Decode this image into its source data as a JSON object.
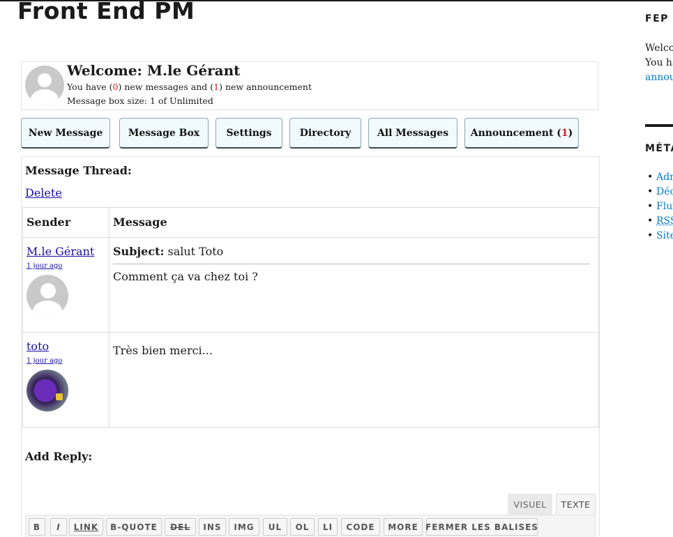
{
  "site": {
    "title": "Front End PM"
  },
  "header": {
    "welcome_prefix": "Welcome: ",
    "user_name": "M.le Gérant",
    "line1_a": "You have (",
    "new_messages": "0",
    "line1_b": ") new messages and (",
    "new_announcements": "1",
    "line1_c": ") new announcement",
    "line2": "Message box size: 1 of Unlimited"
  },
  "nav": {
    "new_message": "New Message",
    "message_box": "Message Box",
    "settings": "Settings",
    "directory": "Directory",
    "all_messages": "All Messages",
    "announcement_label": "Announcement (",
    "announcement_count": "1",
    "announcement_close": ")"
  },
  "thread": {
    "heading": "Message Thread:",
    "delete": "Delete",
    "columns": {
      "sender": "Sender",
      "message": "Message"
    },
    "messages": [
      {
        "sender": "M.le Gérant",
        "time": "1 jour ago",
        "subject_label": "Subject:",
        "subject": "salut Toto",
        "body": "Comment ça va chez toi ?"
      },
      {
        "sender": "toto",
        "time": "1 jour ago",
        "body": "Très bien merci..."
      }
    ],
    "add_reply": "Add Reply:"
  },
  "editor": {
    "tabs": {
      "visuel": "VISUEL",
      "texte": "TEXTE"
    },
    "buttons": {
      "b": "B",
      "i": "I",
      "link": "LINK",
      "bquote": "B-QUOTE",
      "del": "DEL",
      "ins": "INS",
      "img": "IMG",
      "ul": "UL",
      "ol": "OL",
      "li": "LI",
      "code": "CODE",
      "more": "MORE",
      "close_tags": "FERMER LES BALISES"
    }
  },
  "sidebar": {
    "widget1_title": "FEP T",
    "widget1_line1": "Welco",
    "widget1_line2": "You ha",
    "widget1_link": "annou",
    "widget2_title": "MÉTA",
    "meta_links": [
      "Adm",
      "Déc",
      "Flux",
      "RSS",
      "Site"
    ]
  },
  "colors": {
    "accent_red": "#d02020",
    "link": "#1a0dab",
    "sidebar_link": "#007acc",
    "button_bg": "#f1fbff"
  }
}
